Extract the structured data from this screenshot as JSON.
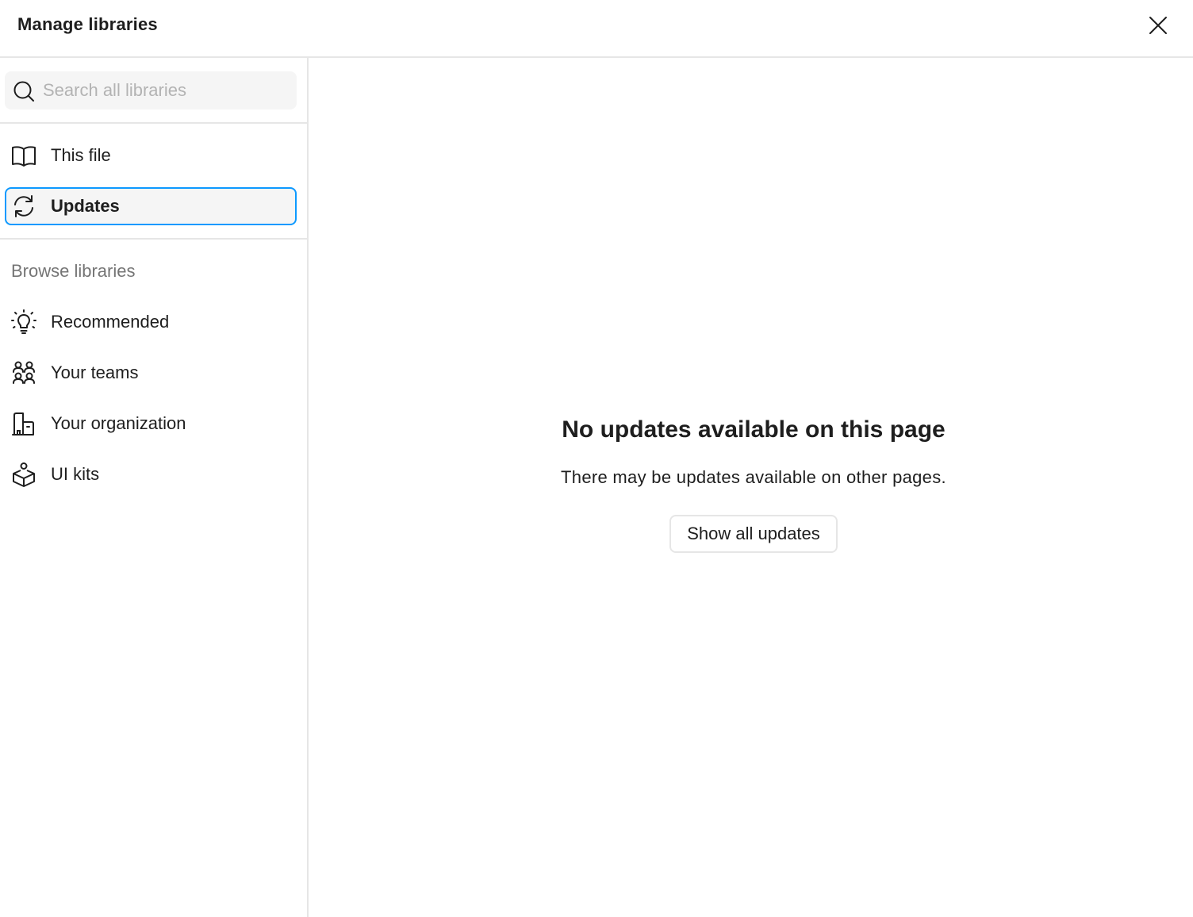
{
  "header": {
    "title": "Manage libraries",
    "close_icon": "close-icon"
  },
  "sidebar": {
    "search": {
      "placeholder": "Search all libraries",
      "value": "",
      "icon": "search-icon"
    },
    "items": [
      {
        "label": "This file",
        "icon": "book-icon",
        "selected": false
      },
      {
        "label": "Updates",
        "icon": "refresh-icon",
        "selected": true
      }
    ],
    "browse": {
      "heading": "Browse libraries",
      "items": [
        {
          "label": "Recommended",
          "icon": "lightbulb-icon"
        },
        {
          "label": "Your teams",
          "icon": "team-icon"
        },
        {
          "label": "Your organization",
          "icon": "organization-icon"
        },
        {
          "label": "UI kits",
          "icon": "ui-kit-icon"
        }
      ]
    }
  },
  "main": {
    "empty_title": "No updates available on this page",
    "empty_description": "There may be updates available on other pages.",
    "button_label": "Show all updates"
  },
  "colors": {
    "accent": "#0d99ff",
    "text": "#1e1e1e",
    "muted": "#757575",
    "placeholder": "#b3b3b3",
    "border": "#e6e6e6",
    "surface": "#f5f5f5"
  }
}
